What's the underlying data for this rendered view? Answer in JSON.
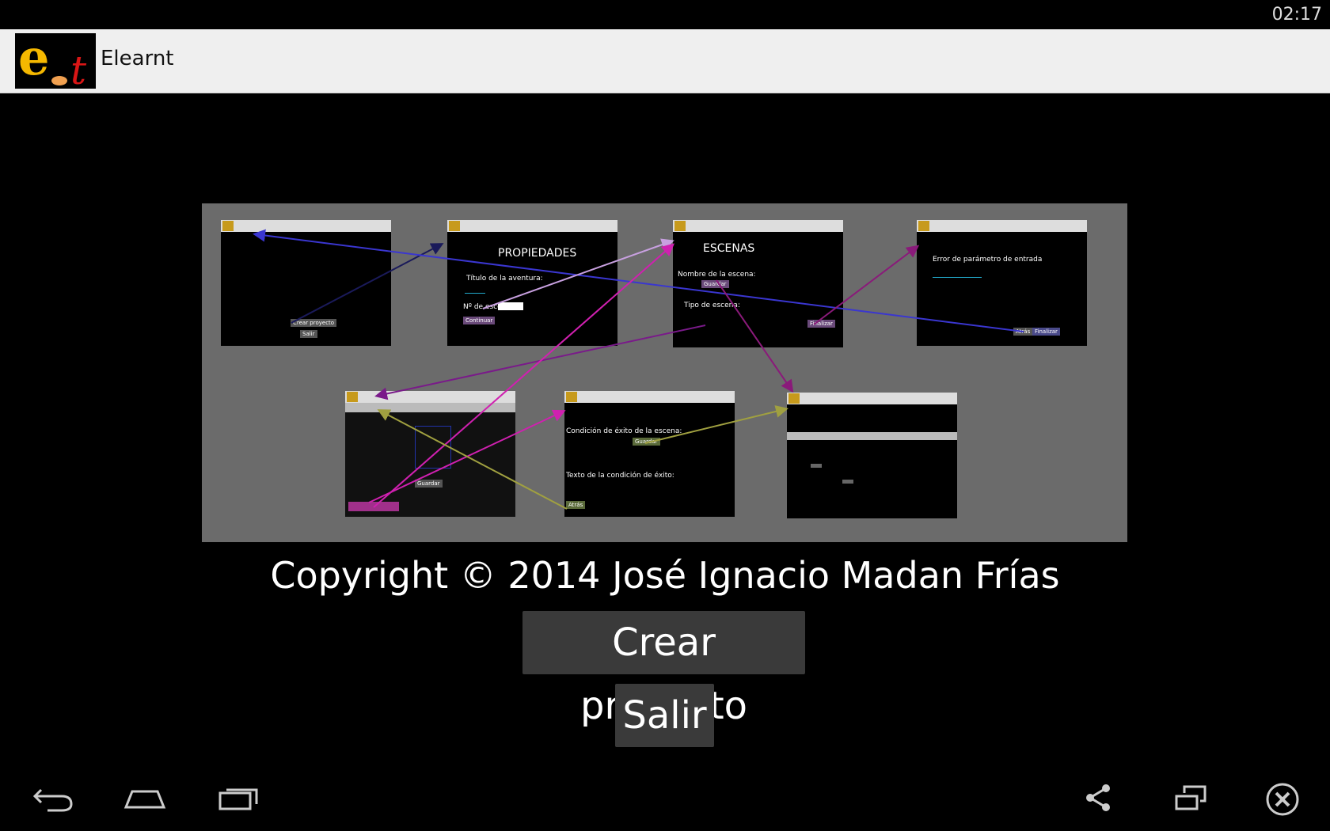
{
  "status_bar": {
    "time": "02:17"
  },
  "action_bar": {
    "title": "Elearnt",
    "logo": {
      "letters": "et"
    }
  },
  "diagram": {
    "screens": [
      {
        "id": "main",
        "texts": [],
        "buttons": [
          "Crear proyecto",
          "Salir"
        ]
      },
      {
        "id": "propiedades",
        "heading": "PROPIEDADES",
        "texts": [
          "Título de la aventura:",
          "Nº de escenas:"
        ],
        "buttons": [
          "Continuar"
        ]
      },
      {
        "id": "escenas",
        "heading": "ESCENAS",
        "texts": [
          "Nombre de la escena:",
          "Tipo de escena:"
        ],
        "buttons": [
          "Guardar",
          "Finalizar"
        ]
      },
      {
        "id": "error",
        "texts": [
          "Error de parámetro de entrada"
        ],
        "buttons": [
          "Atrás",
          "Finalizar"
        ]
      },
      {
        "id": "editor",
        "texts": [],
        "buttons": [
          "Guardar"
        ]
      },
      {
        "id": "condiciones",
        "texts": [
          "Condición de éxito de la escena:",
          "Texto de la condición de éxito:"
        ],
        "buttons": [
          "Guardar",
          "Atrás"
        ]
      },
      {
        "id": "resumen",
        "texts": [],
        "buttons": []
      }
    ]
  },
  "footer": {
    "copyright": "Copyright © 2014 José Ignacio Madan Frías",
    "create_label": "Crear proyecto",
    "exit_label": "Salir"
  },
  "nav_bar": {
    "icons": [
      "back-icon",
      "home-icon",
      "recent-apps-icon",
      "share-icon",
      "window-icon",
      "close-icon"
    ]
  },
  "colors": {
    "background": "#000000",
    "action_bar": "#efefef",
    "diagram_bg": "#6b6b6b",
    "button": "#3a3a3a"
  }
}
